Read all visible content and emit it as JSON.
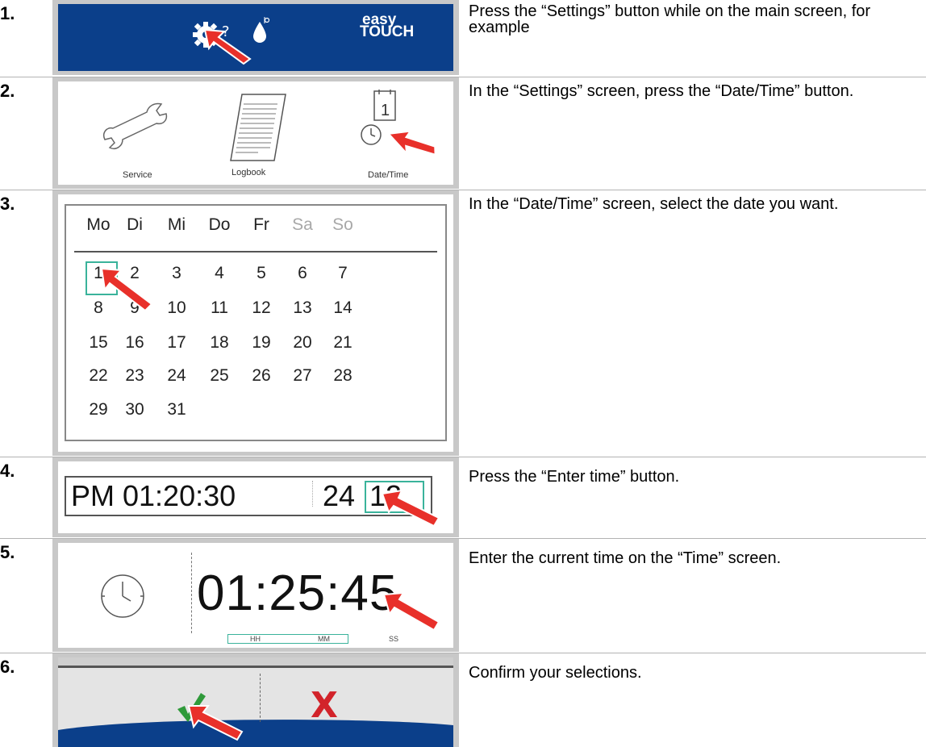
{
  "steps": [
    {
      "number": "1.",
      "text": "Press the “Settings” button while on the main screen, for example"
    },
    {
      "number": "2.",
      "text": "In the “Settings” screen, press the “Date/Time” button."
    },
    {
      "number": "3.",
      "text": "In the “Date/Time” screen, select the date you want."
    },
    {
      "number": "4.",
      "text": "Press the “Enter time” button."
    },
    {
      "number": "5.",
      "text": "Enter the current time on the “Time” screen."
    },
    {
      "number": "6.",
      "text": "Confirm your selections."
    }
  ],
  "step1": {
    "logo_top": "easy",
    "logo_bottom": "TOUCH",
    "brand_color": "#0b3f8a"
  },
  "step2": {
    "items": [
      {
        "label": "Service",
        "icon": "wrench-icon"
      },
      {
        "label": "Logbook",
        "icon": "logbook-icon"
      },
      {
        "label": "Date/Time",
        "icon": "calendar-clock-icon",
        "calendar_day": "1"
      }
    ]
  },
  "step3": {
    "weekdays": [
      "Mo",
      "Di",
      "Mi",
      "Do",
      "Fr",
      "Sa",
      "So"
    ],
    "weeks": [
      [
        "1",
        "2",
        "3",
        "4",
        "5",
        "6",
        "7"
      ],
      [
        "8",
        "9",
        "10",
        "11",
        "12",
        "13",
        "14"
      ],
      [
        "15",
        "16",
        "17",
        "18",
        "19",
        "20",
        "21"
      ],
      [
        "22",
        "23",
        "24",
        "25",
        "26",
        "27",
        "28"
      ],
      [
        "29",
        "30",
        "31",
        "",
        "",
        "",
        ""
      ]
    ],
    "selected_day": "1",
    "selection_color": "#3ab39b"
  },
  "step4": {
    "time": "PM 01:20:30",
    "format24": "24",
    "format12": "12"
  },
  "step5": {
    "time": "01:25:45",
    "units": [
      "HH",
      "MM",
      "SS"
    ]
  },
  "step6": {
    "confirm_icon": "checkmark-icon",
    "cancel_icon": "cross-icon",
    "cancel_glyph": "X"
  }
}
